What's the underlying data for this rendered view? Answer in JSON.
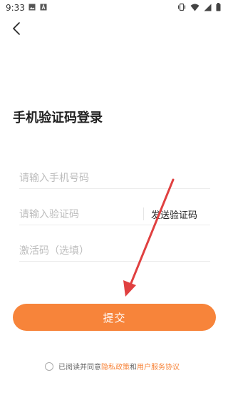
{
  "status_bar": {
    "time": "9:33",
    "left_icons": [
      "image-icon",
      "font-icon"
    ],
    "right_icons": [
      "vibrate-icon",
      "wifi-icon",
      "signal-icon",
      "battery-icon"
    ]
  },
  "header": {
    "back_icon": "back-icon"
  },
  "login": {
    "title": "手机验证码登录",
    "phone_placeholder": "请输入手机号码",
    "code_placeholder": "请输入验证码",
    "send_code_label": "发送验证码",
    "activation_placeholder": "激活码（选填）",
    "submit_label": "提交"
  },
  "agreement": {
    "prefix": "已阅读并同意",
    "privacy_label": "隐私政策",
    "and": "和",
    "terms_label": "用户服务协议"
  },
  "colors": {
    "accent": "#f7843a",
    "annotation_arrow": "#e04040"
  }
}
